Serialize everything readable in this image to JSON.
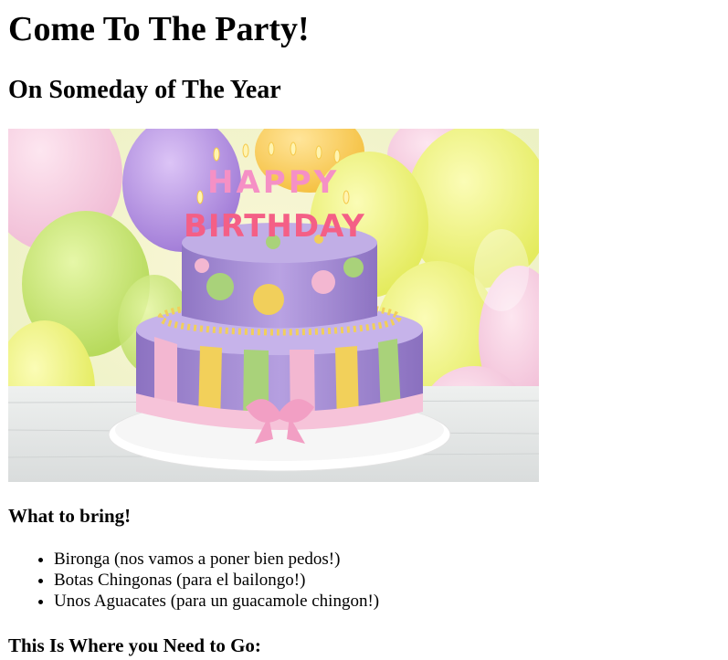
{
  "page": {
    "title": "Come To The Party!",
    "subtitle": "On Someday of The Year"
  },
  "hero_image": {
    "cake_topper_word1": "HAPPY",
    "cake_topper_word2": "BIRTHDAY"
  },
  "bring_section": {
    "heading": "What to bring!",
    "items": [
      "Bironga (nos vamos a poner bien pedos!)",
      "Botas Chingonas (para el bailongo!)",
      "Unos Aguacates (para un guacamole chingon!)"
    ]
  },
  "where_section": {
    "heading": "This Is Where you Need to Go:"
  },
  "colors": {
    "text": "#000000",
    "background": "#ffffff",
    "cake_purple": "#a98fd6",
    "cake_pink": "#f4b8d2",
    "cake_green": "#a9d27a",
    "cake_yellow": "#f1cf5b",
    "balloon_yellow": "#eef07a",
    "balloon_purple": "#b48ee0"
  }
}
